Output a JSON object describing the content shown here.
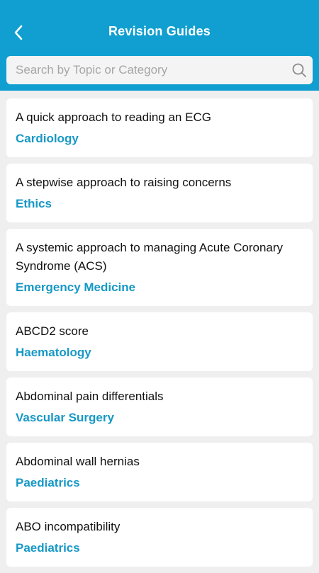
{
  "header": {
    "title": "Revision Guides",
    "back_icon": "chevron-left-icon"
  },
  "search": {
    "placeholder": "Search by Topic or Category",
    "value": "",
    "icon": "search-icon"
  },
  "colors": {
    "header_bg": "#109fd0",
    "category_text": "#1798c6",
    "page_bg": "#efefef"
  },
  "guides": [
    {
      "title": "A quick approach to reading an ECG",
      "category": "Cardiology"
    },
    {
      "title": "A stepwise approach to raising concerns",
      "category": "Ethics"
    },
    {
      "title": "A systemic approach to managing Acute Coronary Syndrome (ACS)",
      "category": "Emergency Medicine"
    },
    {
      "title": "ABCD2 score",
      "category": "Haematology"
    },
    {
      "title": "Abdominal pain differentials",
      "category": "Vascular Surgery"
    },
    {
      "title": "Abdominal wall hernias",
      "category": "Paediatrics"
    },
    {
      "title": "ABO incompatibility",
      "category": "Paediatrics"
    }
  ]
}
